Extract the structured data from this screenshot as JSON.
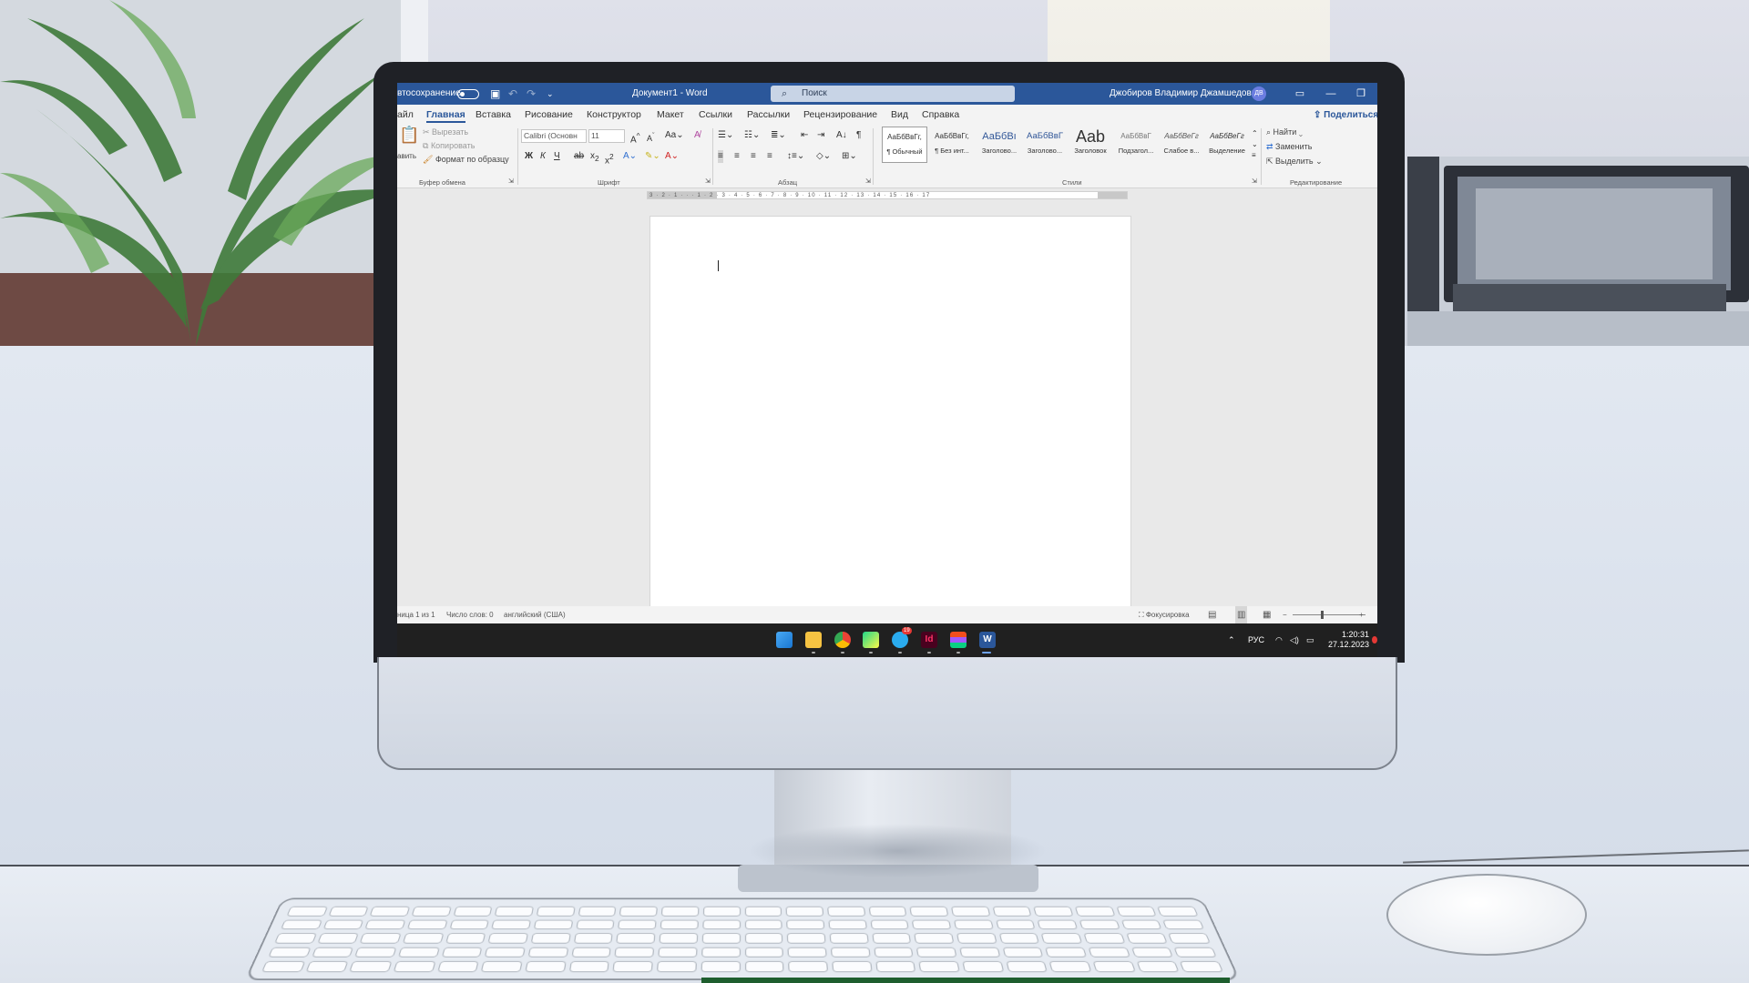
{
  "window": {
    "autosave_label": "втосохранение",
    "document_title": "Документ1 - Word",
    "search_placeholder": "Поиск",
    "user_name": "Джобиров Владимир Джамшедович",
    "user_initials": "ДВ"
  },
  "tabs": [
    "айл",
    "Главная",
    "Вставка",
    "Рисование",
    "Конструктор",
    "Макет",
    "Ссылки",
    "Рассылки",
    "Рецензирование",
    "Вид",
    "Справка"
  ],
  "active_tab": "Главная",
  "share_label": "Поделиться",
  "ribbon": {
    "clipboard": {
      "paste_label": "авить",
      "cut_label": "Вырезать",
      "copy_label": "Копировать",
      "format_painter_label": "Формат по образцу",
      "group_label": "Буфер обмена"
    },
    "font": {
      "font_name": "Calibri (Основн",
      "font_size": "11",
      "bold": "Ж",
      "italic": "К",
      "underline": "Ч",
      "strike": "ab",
      "group_label": "Шрифт"
    },
    "paragraph": {
      "group_label": "Абзац"
    },
    "styles": {
      "items": [
        {
          "sample": "АаБбВвГг,",
          "name": "¶ Обычный"
        },
        {
          "sample": "АаБбВвГг,",
          "name": "¶ Без инт..."
        },
        {
          "sample": "АаБбВı",
          "name": "Заголово..."
        },
        {
          "sample": "АаБбВвГ",
          "name": "Заголово..."
        },
        {
          "sample": "Aab",
          "name": "Заголовок"
        },
        {
          "sample": "АаБбВвГ",
          "name": "Подзагол..."
        },
        {
          "sample": "АаБбВеГг",
          "name": "Слабое в..."
        },
        {
          "sample": "АаБбВеГг",
          "name": "Выделение"
        }
      ],
      "group_label": "Стили"
    },
    "editing": {
      "find_label": "Найти",
      "replace_label": "Заменить",
      "select_label": "Выделить",
      "group_label": "Редактирование"
    }
  },
  "ruler": {
    "ticks": "3 · 2 · 1 · · · 1 · 2 · 3 · 4 · 5 · 6 · 7 · 8 · 9 · 10 · 11 · 12 · 13 · 14 · 15 · 16 · 17"
  },
  "statusbar": {
    "page": "ница 1 из 1",
    "words": "Число слов: 0",
    "language": "английский (США)",
    "focus": "Фокусировка"
  },
  "taskbar": {
    "language": "РУС",
    "time": "1:20:31",
    "date": "27.12.2023",
    "telegram_badge": "19",
    "apps": [
      "start-icon",
      "file-explorer-icon",
      "chrome-icon",
      "pycharm-icon",
      "telegram-icon",
      "indesign-icon",
      "figma-icon",
      "word-icon"
    ]
  },
  "colors": {
    "word_blue": "#2b579a",
    "taskbar": "#202020"
  }
}
